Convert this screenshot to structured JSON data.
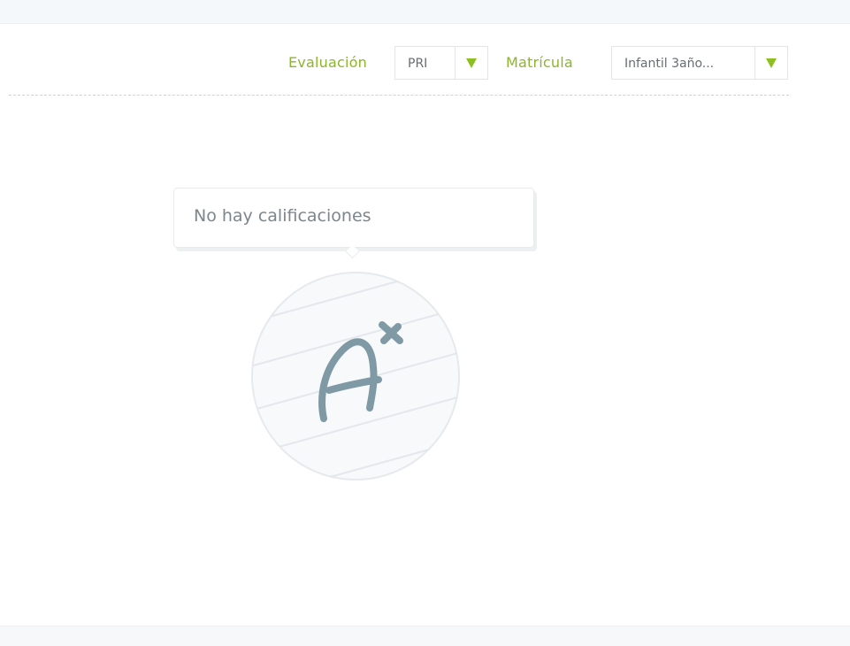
{
  "filters": {
    "evaluacion": {
      "label": "Evaluación",
      "value": "PRI"
    },
    "matricula": {
      "label": "Matrícula",
      "value": "Infantil 3año..."
    }
  },
  "empty_state": {
    "message": "No hay calificaciones",
    "icon": "grade-a-plus-icon"
  },
  "colors": {
    "accent_green": "#8cb42c",
    "arrow_green": "#8cc020",
    "separator_orange": "#f3c7aa",
    "icon_stroke": "#7f9aa5"
  }
}
